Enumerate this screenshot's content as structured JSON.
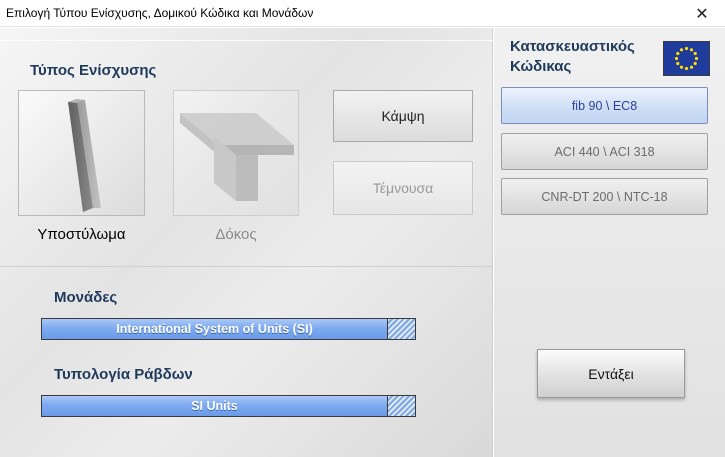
{
  "window": {
    "title": "Επιλογή Τύπου Ενίσχυσης, Δομικού Κώδικα και Μονάδων",
    "close_glyph": "✕"
  },
  "reinforcement": {
    "section_title": "Τύπος Ενίσχυσης",
    "tiles": [
      {
        "label": "Υποστύλωμα",
        "enabled": true,
        "icon": "column-icon"
      },
      {
        "label": "Δόκος",
        "enabled": false,
        "icon": "beam-icon"
      }
    ],
    "buttons": [
      {
        "label": "Κάμψη",
        "enabled": true
      },
      {
        "label": "Τέμνουσα",
        "enabled": false
      }
    ]
  },
  "units": {
    "section_title": "Μονάδες",
    "selected": "International System of Units (SI)"
  },
  "bars": {
    "section_title": "Τυπολογία Ράβδων",
    "selected": "SI Units"
  },
  "codes": {
    "title_line1": "Κατασκευαστικός",
    "title_line2": "Κώδικας",
    "flag_icon": "eu-flag-icon",
    "options": [
      {
        "label": "fib 90 \\ EC8",
        "selected": true
      },
      {
        "label": "ACI 440 \\ ACI 318",
        "selected": false
      },
      {
        "label": "CNR-DT 200 \\ NTC-18",
        "selected": false
      }
    ]
  },
  "ok_label": "Εντάξει",
  "colors": {
    "heading": "#1f3a5a",
    "dropdown_blue": "#7eaaf0",
    "selected_code": "#2d3f9a"
  }
}
